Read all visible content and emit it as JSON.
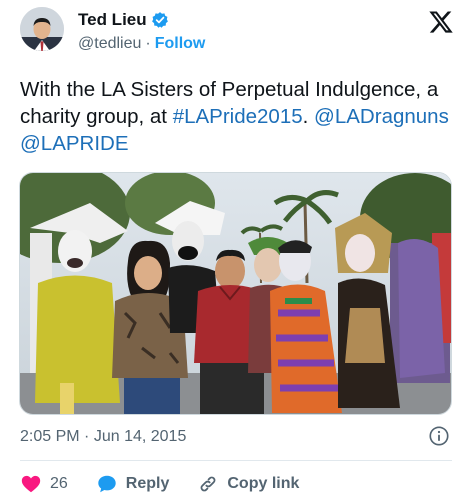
{
  "author": {
    "name": "Ted Lieu",
    "handle": "@tedlieu",
    "separator": "·",
    "follow_label": "Follow"
  },
  "tweet": {
    "text_plain": "With the LA Sisters of Perpetual Indulgence, a charity group, at ",
    "hashtag": "#LAPride2015",
    "mention1": "@LADragnuns",
    "mention2": "@LAPRIDE"
  },
  "meta": {
    "time": "2:05 PM",
    "separator": "·",
    "date": "Jun 14, 2015"
  },
  "actions": {
    "like_count": "26",
    "reply_label": "Reply",
    "copy_label": "Copy link"
  },
  "colors": {
    "accent": "#1d9bf0",
    "like": "#f91880",
    "reply": "#1d9bf0",
    "text": "#0f1419",
    "muted": "#536471"
  },
  "icons": [
    "verified-badge-icon",
    "x-logo-icon",
    "info-icon",
    "heart-icon",
    "reply-bubble-icon",
    "link-icon"
  ]
}
